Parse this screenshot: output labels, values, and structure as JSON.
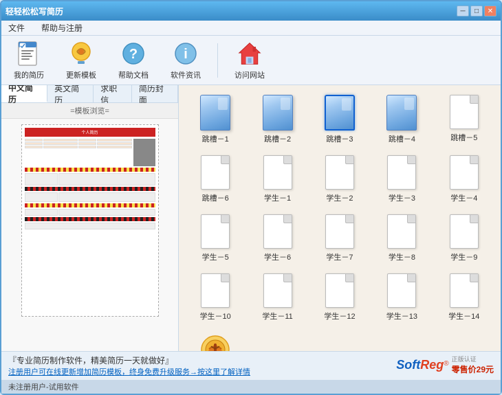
{
  "window": {
    "title": "轻轻松松写简历",
    "min_btn": "─",
    "max_btn": "□",
    "close_btn": "✕"
  },
  "menu": {
    "items": [
      "文件",
      "帮助与注册"
    ]
  },
  "toolbar": {
    "buttons": [
      {
        "label": "我的简历",
        "icon": "resume-icon"
      },
      {
        "label": "更新模板",
        "icon": "update-icon"
      },
      {
        "label": "帮助文档",
        "icon": "help-icon"
      },
      {
        "label": "软件资讯",
        "icon": "info-icon"
      },
      {
        "label": "访问网站",
        "icon": "website-icon"
      }
    ]
  },
  "tabs": {
    "items": [
      "中文简历",
      "英文简历",
      "求职信",
      "简历封面"
    ],
    "active": 0
  },
  "preview": {
    "label": "=模板浏览="
  },
  "templates": {
    "items": [
      {
        "label": "跳槽－1",
        "type": "blue"
      },
      {
        "label": "跳槽－2",
        "type": "blue"
      },
      {
        "label": "跳槽－3",
        "type": "blue",
        "selected": true
      },
      {
        "label": "跳槽－4",
        "type": "blue"
      },
      {
        "label": "跳槽－5",
        "type": "white"
      },
      {
        "label": "跳槽－6",
        "type": "white"
      },
      {
        "label": "学生－1",
        "type": "white"
      },
      {
        "label": "学生－2",
        "type": "white"
      },
      {
        "label": "学生－3",
        "type": "white"
      },
      {
        "label": "学生－4",
        "type": "white"
      },
      {
        "label": "学生－5",
        "type": "white"
      },
      {
        "label": "学生－6",
        "type": "white"
      },
      {
        "label": "学生－7",
        "type": "white"
      },
      {
        "label": "学生－8",
        "type": "white"
      },
      {
        "label": "学生－9",
        "type": "white"
      },
      {
        "label": "学生－10",
        "type": "white"
      },
      {
        "label": "学生－11",
        "type": "white"
      },
      {
        "label": "学生－12",
        "type": "white"
      },
      {
        "label": "学生－13",
        "type": "white"
      },
      {
        "label": "学生－14",
        "type": "white"
      },
      {
        "label": "more",
        "type": "more"
      }
    ]
  },
  "bottom": {
    "promo_1": "『专业简历制作软件，精美简历一天就做好』",
    "promo_2": "注册用户可在线更新增加简历模板，终身免费升级服务→按这里了解详情",
    "status": "未注册用户-试用软件"
  },
  "softreg": {
    "soft": "Soft",
    "reg": "Reg",
    "circle": "®",
    "price": "零售价29元"
  }
}
